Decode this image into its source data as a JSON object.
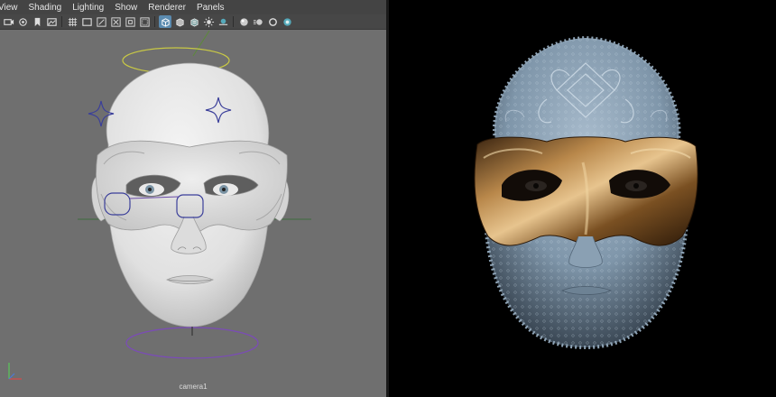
{
  "menubar": {
    "items": [
      {
        "label": "View"
      },
      {
        "label": "Shading"
      },
      {
        "label": "Lighting"
      },
      {
        "label": "Show"
      },
      {
        "label": "Renderer"
      },
      {
        "label": "Panels"
      }
    ]
  },
  "toolbar": {
    "icons": [
      "select-camera-icon",
      "camera-attributes-icon",
      "bookmark-icon",
      "image-plane-icon",
      "grid-icon",
      "film-gate-icon",
      "resolution-gate-icon",
      "gate-mask-icon",
      "field-chart-icon",
      "safe-action-icon",
      "wireframe-icon",
      "smooth-shade-icon",
      "textured-icon",
      "lights-icon",
      "shadows-icon",
      "ambient-occlusion-icon",
      "motion-blur-icon",
      "antialiasing-icon",
      "depth-of-field-icon"
    ]
  },
  "viewport": {
    "camera_label": "camera1",
    "background_color": "#6f6f6f"
  },
  "render_view": {
    "background_color": "#000000"
  }
}
